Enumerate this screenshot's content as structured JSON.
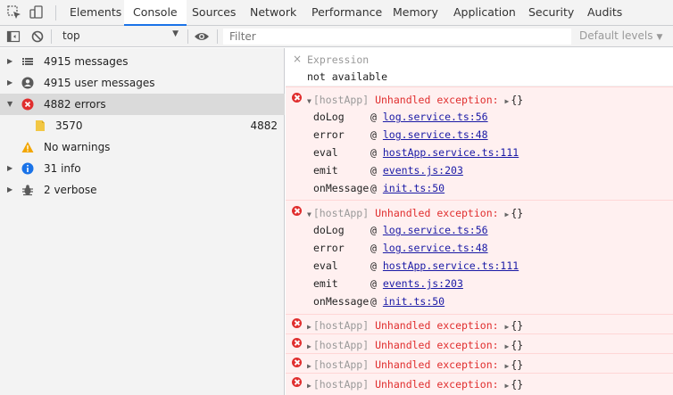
{
  "tabs": [
    {
      "label": "Elements"
    },
    {
      "label": "Console"
    },
    {
      "label": "Sources"
    },
    {
      "label": "Network"
    },
    {
      "label": "Performance"
    },
    {
      "label": "Memory"
    },
    {
      "label": "Application"
    },
    {
      "label": "Security"
    },
    {
      "label": "Audits"
    }
  ],
  "active_tab": "Console",
  "toolbar": {
    "context": "top",
    "filter_placeholder": "Filter",
    "levels_label": "Default levels"
  },
  "sidebar": {
    "items": [
      {
        "label": "4915 messages",
        "icon": "list-icon"
      },
      {
        "label": "4915 user messages",
        "icon": "user-icon"
      },
      {
        "label": "4882 errors",
        "icon": "error-icon"
      },
      {
        "label": "3570",
        "count": "4882",
        "icon": "file-icon"
      },
      {
        "label": "No warnings",
        "icon": "warning-icon"
      },
      {
        "label": "31 info",
        "icon": "info-icon"
      },
      {
        "label": "2 verbose",
        "icon": "bug-icon"
      }
    ]
  },
  "console": {
    "expression": {
      "name": "Expression",
      "value": "not available"
    },
    "errors": [
      {
        "tag": "[hostApp]",
        "message": "Unhandled exception:",
        "obj": "{}",
        "expanded": true,
        "trace": [
          {
            "fn": "doLog",
            "at": "@",
            "link": "log.service.ts:56"
          },
          {
            "fn": "error",
            "at": "@",
            "link": "log.service.ts:48"
          },
          {
            "fn": "eval",
            "at": "@",
            "link": "hostApp.service.ts:111"
          },
          {
            "fn": "emit",
            "at": "@",
            "link": "events.js:203"
          },
          {
            "fn": "onMessage",
            "at": "@",
            "link": "init.ts:50"
          }
        ]
      },
      {
        "tag": "[hostApp]",
        "message": "Unhandled exception:",
        "obj": "{}",
        "expanded": true,
        "trace": [
          {
            "fn": "doLog",
            "at": "@",
            "link": "log.service.ts:56"
          },
          {
            "fn": "error",
            "at": "@",
            "link": "log.service.ts:48"
          },
          {
            "fn": "eval",
            "at": "@",
            "link": "hostApp.service.ts:111"
          },
          {
            "fn": "emit",
            "at": "@",
            "link": "events.js:203"
          },
          {
            "fn": "onMessage",
            "at": "@",
            "link": "init.ts:50"
          }
        ]
      },
      {
        "tag": "[hostApp]",
        "message": "Unhandled exception:",
        "obj": "{}",
        "expanded": false
      },
      {
        "tag": "[hostApp]",
        "message": "Unhandled exception:",
        "obj": "{}",
        "expanded": false
      },
      {
        "tag": "[hostApp]",
        "message": "Unhandled exception:",
        "obj": "{}",
        "expanded": false
      },
      {
        "tag": "[hostApp]",
        "message": "Unhandled exception:",
        "obj": "{}",
        "expanded": false
      }
    ]
  },
  "colors": {
    "accent": "#1a73e8",
    "error": "#e02e2e",
    "error_bg": "#fff0f0",
    "link": "#1a1aa6",
    "info": "#1a73e8",
    "warning": "#f2a600"
  }
}
